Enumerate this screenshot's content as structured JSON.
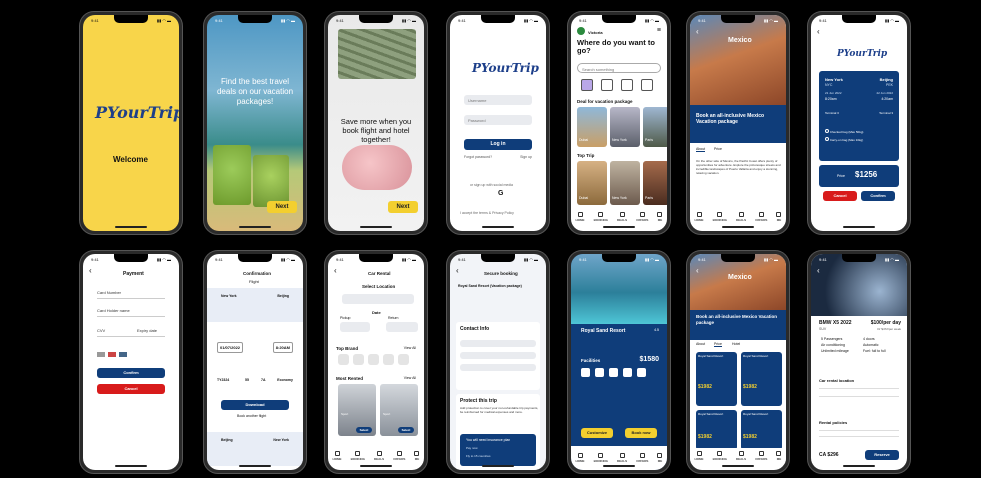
{
  "s1": {
    "time": "9:41",
    "logo": "PYourTrip",
    "welcome": "Welcome"
  },
  "s2": {
    "time": "9:41",
    "headline": "Find the best travel deals on our vacation packages!",
    "next": "Next"
  },
  "s3": {
    "time": "9:41",
    "headline": "Save more when you book flight and hotel together!",
    "next": "Next"
  },
  "s4": {
    "time": "9:41",
    "logo": "PYourTrip",
    "username_ph": "Username",
    "password_ph": "Password",
    "login": "Log in",
    "forgot": "Forgot password?",
    "signup": "Sign up",
    "social_text": "or sign up with social media",
    "google": "G",
    "terms": "I accept the terms & Privacy Policy"
  },
  "s5": {
    "time": "9:41",
    "user": "Victoria",
    "title": "Where do you want to go?",
    "search_ph": "Search something",
    "deal_title": "Deal for vacation package",
    "deals": [
      "Dubai",
      "New York",
      "Paris"
    ],
    "top_title": "Top Trip",
    "tops": [
      "Dubai",
      "New York",
      "Paris"
    ]
  },
  "s6": {
    "time": "9:41",
    "city": "Mexico",
    "headline": "Book an all-inclusive Mexico Vacation package",
    "tabs": [
      "About",
      "Price"
    ],
    "body": "On the other side of Mexico, the Pacific Coast offers plenty of opportunities for adventure. Explore the picturesque streets and incredible landscapes of Puerto Vallarta and enjoy a stunning, relaxing vacation."
  },
  "s7": {
    "time": "9:41",
    "logo": "PYourTrip",
    "from_city": "New York",
    "from_code": "NYC",
    "to_city": "Beijing",
    "to_code": "PEK",
    "date1": "21 Jun 2022",
    "date2": "22 Jun 2022",
    "t1": "8:20am",
    "t2": "4:20am",
    "g1": "Terminal 3",
    "g2": "Terminal 3",
    "opt1": "Checked bag (Max 50kg)",
    "opt2": "Carry-on bag (Max 10kg)",
    "total_label": "Price",
    "total": "$1256",
    "cancel": "Cancel",
    "confirm": "Confirm"
  },
  "s8": {
    "time": "9:41",
    "title": "Payment",
    "card_number": "Card Number",
    "card_holder": "Card Holder name",
    "cvv": "CVV",
    "expiry": "Expiry date",
    "confirm": "Confirm",
    "cancel": "Cancel"
  },
  "s9": {
    "time": "9:41",
    "title": "Confirmation",
    "subtitle": "Flight",
    "from": "New York",
    "to": "Beijing",
    "date": "01/07/2022",
    "time_val": "8:20AM",
    "flight": "TY2324",
    "seat": "55",
    "gate": "7A",
    "cls": "Economy",
    "download": "Download",
    "book_another": "Book another flight",
    "ret_from": "Beijing",
    "ret_to": "New York"
  },
  "s10": {
    "time": "9:41",
    "title": "Car Rental",
    "subtitle": "Select Location",
    "date_label": "Date",
    "pickup": "Pickup",
    "return": "Return",
    "top_brand": "Top Brand",
    "view_all": "View All",
    "most_rented": "Most Rented",
    "view_all2": "View All",
    "car1": "Sport",
    "car2": "Sport",
    "select": "Select"
  },
  "s11": {
    "time": "9:41",
    "title": "Secure booking",
    "hotel": "Royal Sand Resort (Vacation package)",
    "contact": "Contact Info",
    "protect": "Protect this trip",
    "protect_text": "Add protection to cover your non-refundable trip payments, be reimbursed for medical expenses and more.",
    "pay_title": "You will need insurance plan",
    "pay_sub": "Pay now",
    "price_note": "Fly to 15 countries"
  },
  "s12": {
    "time": "9:41",
    "hotel": "Royal Sand Resort",
    "rating": "4.5",
    "facilities": "Facilities",
    "price": "$1580",
    "customize": "Customize",
    "book_now": "Book now"
  },
  "s13": {
    "time": "9:41",
    "city": "Mexico",
    "headline": "Book an all-inclusive Mexico Vacation package",
    "tabs": [
      "About",
      "Price",
      "Hotel"
    ],
    "hotels": [
      {
        "name": "Royal Sand Resort",
        "price": "$1982"
      },
      {
        "name": "Royal Sand Resort",
        "price": "$1982"
      },
      {
        "name": "Royal Sand Resort",
        "price": "$1982"
      },
      {
        "name": "Royal Sand Resort",
        "price": "$1982"
      }
    ]
  },
  "s14": {
    "time": "9:41",
    "car": "BMW X5 2022",
    "car_sub": "SUV",
    "price": "$100/per day",
    "price_sub": "Or $472/per week",
    "features": [
      "5 Passengers",
      "Air conditioning",
      "Unlimited mileage",
      "4 doors",
      "Automatic",
      "Fuel: full to full"
    ],
    "loc_title": "Car rental location",
    "policy_title": "Rental policies",
    "total": "CA $296",
    "reserve": "Reserve"
  },
  "tab_labels": [
    "HOME",
    "BOOKING",
    "DEALS",
    "OFFERS",
    "ME"
  ]
}
